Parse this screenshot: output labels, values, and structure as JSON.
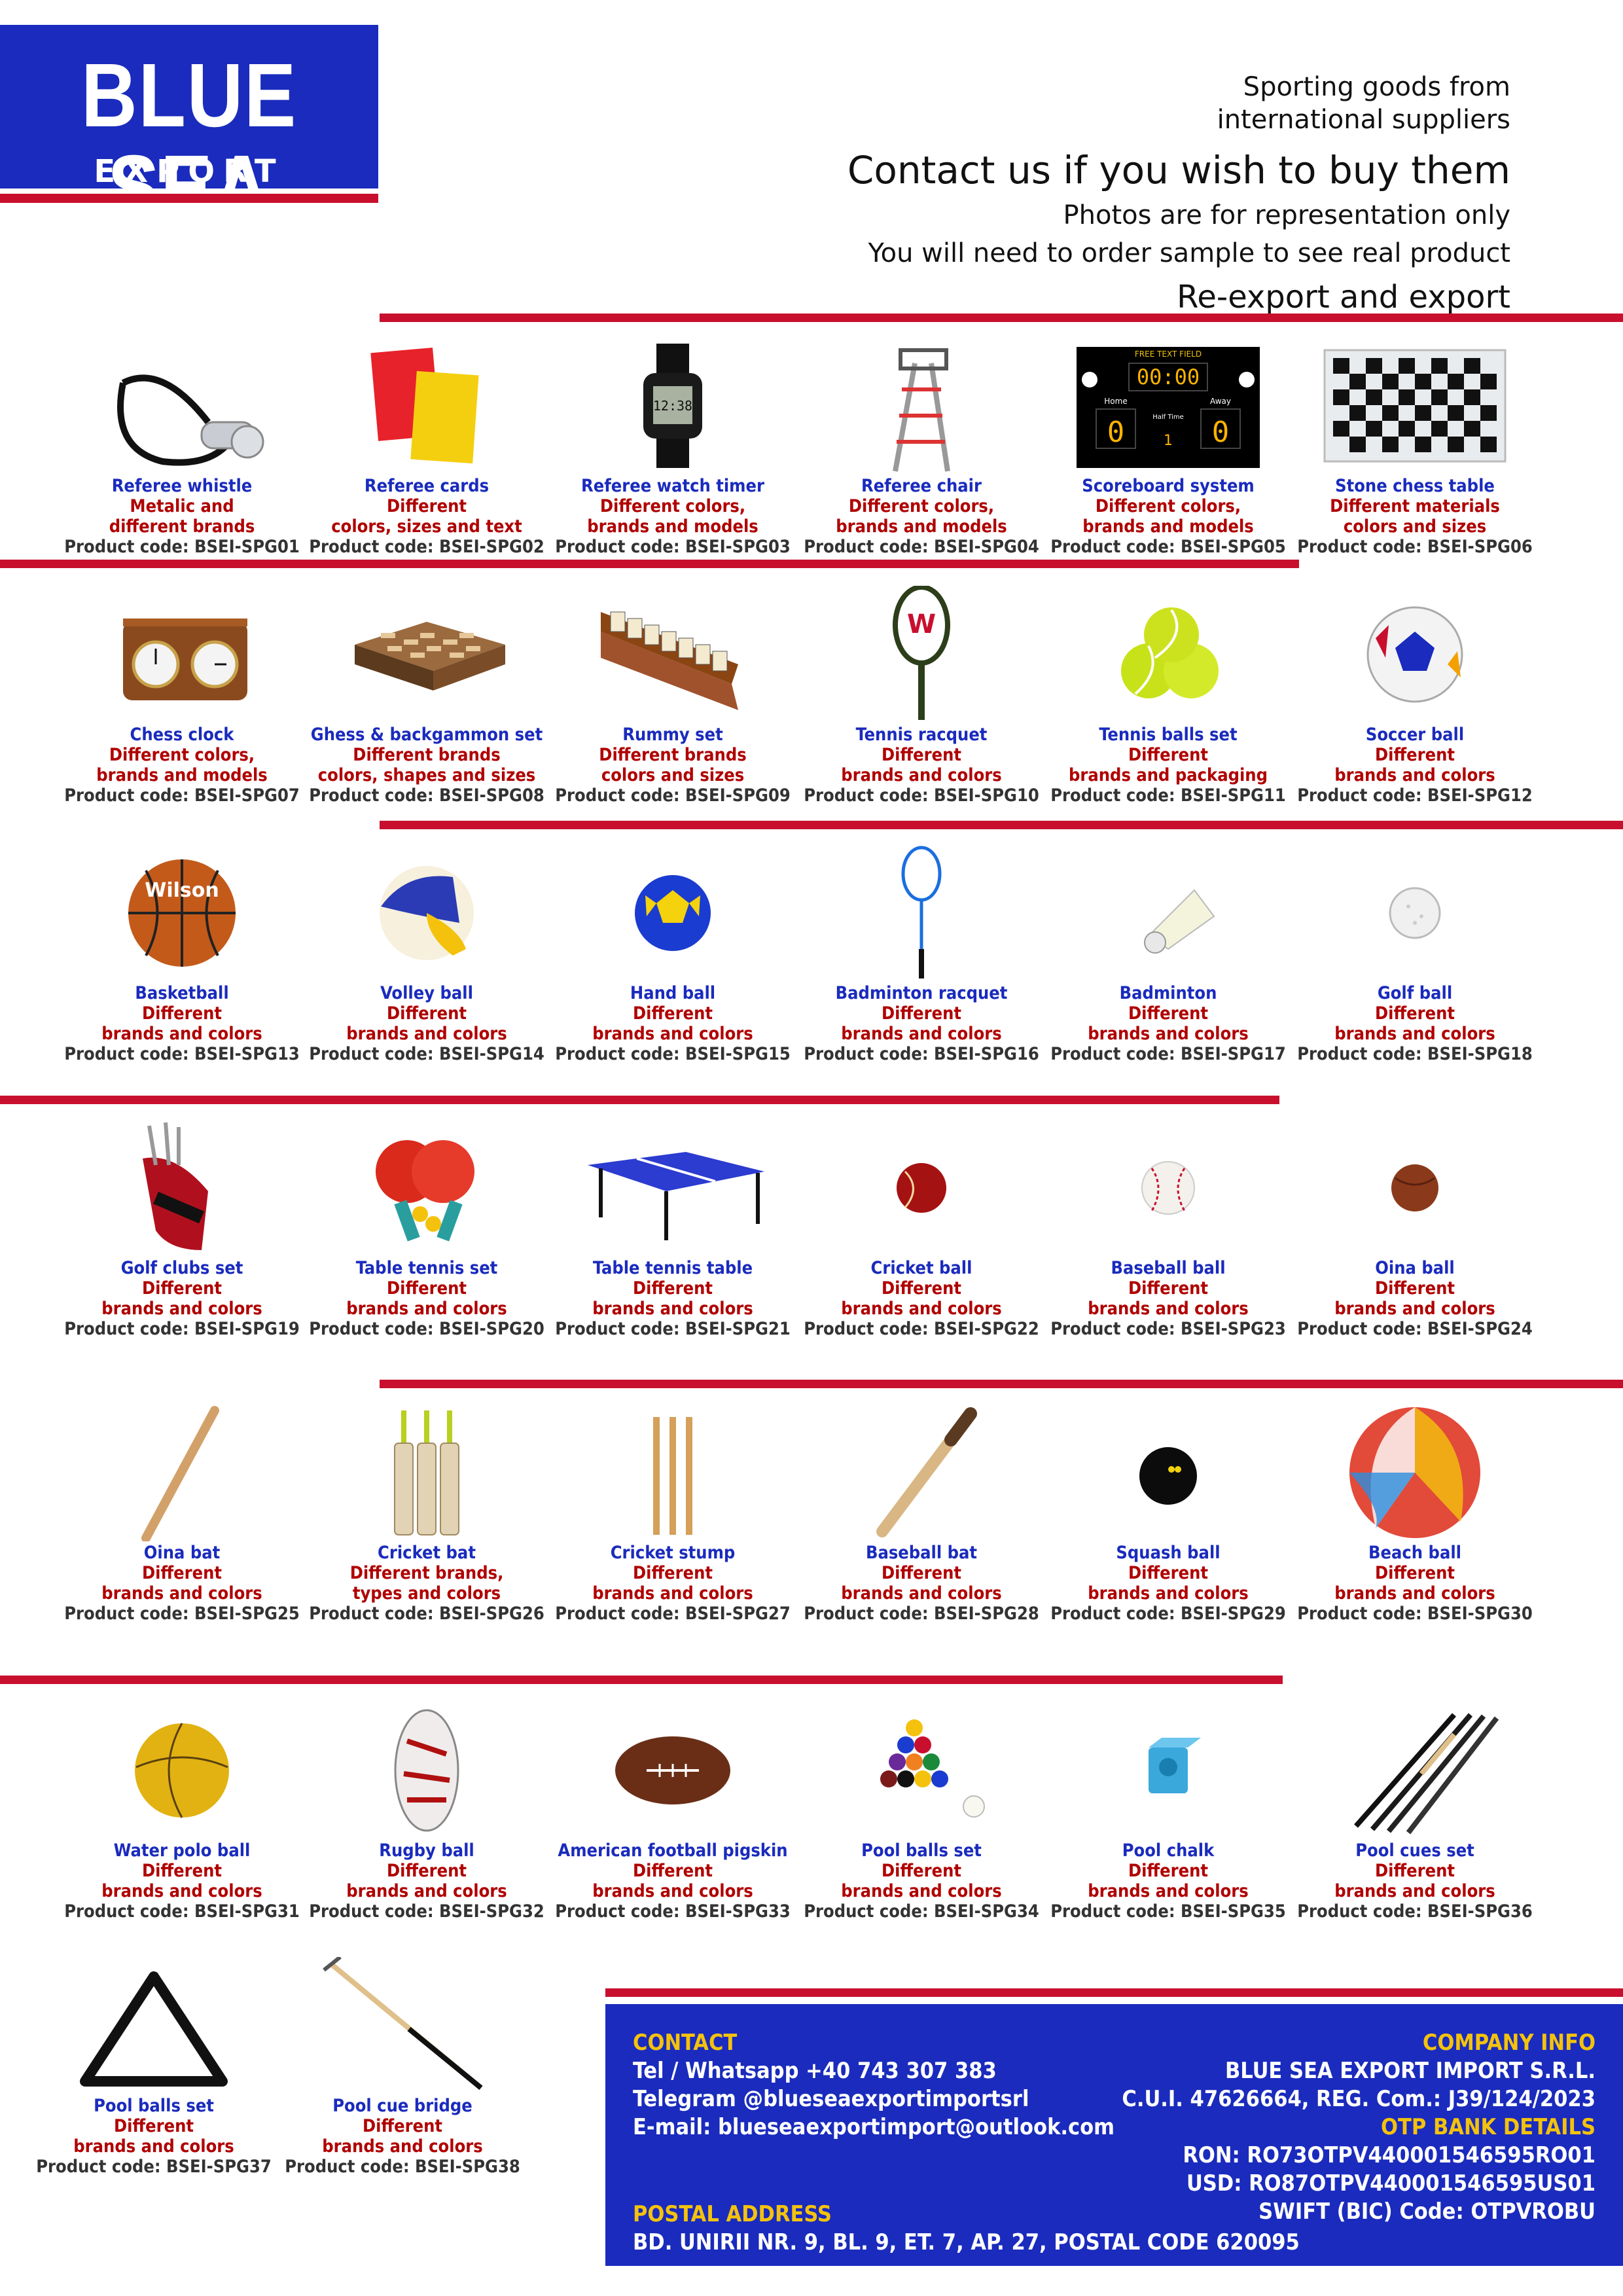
{
  "logo": {
    "title": "BLUE SEA",
    "subtitle": "EXPORT IMPORT"
  },
  "header": {
    "tagline_1": "Sporting goods from",
    "tagline_2": "international suppliers",
    "contact": "Contact us if you wish to buy them",
    "note_1": "Photos are for representation only",
    "note_2": "You will need to order sample to see real product",
    "export": "Re-export and export"
  },
  "colors": {
    "brand_blue": "#1a2bbd",
    "accent_red": "#c8102e",
    "footer_heading": "#f4c20d"
  },
  "products": [
    {
      "name": "Referee whistle",
      "desc": [
        "Metalic and",
        "different brands"
      ],
      "code": "Product code: BSEI-SPG01",
      "icon": "whistle-icon"
    },
    {
      "name": "Referee cards",
      "desc": [
        "Different",
        "colors, sizes and text"
      ],
      "code": "Product code: BSEI-SPG02",
      "icon": "referee-cards-icon"
    },
    {
      "name": "Referee watch timer",
      "desc": [
        "Different colors,",
        "brands and models"
      ],
      "code": "Product code: BSEI-SPG03",
      "icon": "watch-icon"
    },
    {
      "name": "Referee chair",
      "desc": [
        "Different colors,",
        "brands and models"
      ],
      "code": "Product code: BSEI-SPG04",
      "icon": "referee-chair-icon"
    },
    {
      "name": "Scoreboard system",
      "desc": [
        "Different colors,",
        "brands and models"
      ],
      "code": "Product code: BSEI-SPG05",
      "icon": "scoreboard-icon"
    },
    {
      "name": "Stone chess table",
      "desc": [
        "Different materials",
        "colors and sizes"
      ],
      "code": "Product code: BSEI-SPG06",
      "icon": "chess-table-icon"
    },
    {
      "name": "Chess clock",
      "desc": [
        "Different colors,",
        "brands and models"
      ],
      "code": "Product code: BSEI-SPG07",
      "icon": "chess-clock-icon"
    },
    {
      "name": "Ghess & backgammon set",
      "desc": [
        "Different brands",
        "colors, shapes and sizes"
      ],
      "code": "Product code: BSEI-SPG08",
      "icon": "backgammon-icon"
    },
    {
      "name": "Rummy set",
      "desc": [
        "Different brands",
        "colors and sizes"
      ],
      "code": "Product code: BSEI-SPG09",
      "icon": "rummy-icon"
    },
    {
      "name": "Tennis racquet",
      "desc": [
        "Different",
        "brands and colors"
      ],
      "code": "Product code: BSEI-SPG10",
      "icon": "tennis-racquet-icon"
    },
    {
      "name": "Tennis balls set",
      "desc": [
        "Different",
        "brands and packaging"
      ],
      "code": "Product code: BSEI-SPG11",
      "icon": "tennis-balls-icon"
    },
    {
      "name": "Soccer ball",
      "desc": [
        "Different",
        "brands and colors"
      ],
      "code": "Product code: BSEI-SPG12",
      "icon": "soccer-ball-icon"
    },
    {
      "name": "Basketball",
      "desc": [
        "Different",
        "brands and colors"
      ],
      "code": "Product code: BSEI-SPG13",
      "icon": "basketball-icon"
    },
    {
      "name": "Volley ball",
      "desc": [
        "Different",
        "brands and colors"
      ],
      "code": "Product code: BSEI-SPG14",
      "icon": "volleyball-icon"
    },
    {
      "name": "Hand ball",
      "desc": [
        "Different",
        "brands and colors"
      ],
      "code": "Product code: BSEI-SPG15",
      "icon": "handball-icon"
    },
    {
      "name": "Badminton racquet",
      "desc": [
        "Different",
        "brands and colors"
      ],
      "code": "Product code: BSEI-SPG16",
      "icon": "badminton-racquet-icon"
    },
    {
      "name": "Badminton",
      "desc": [
        "Different",
        "brands and colors"
      ],
      "code": "Product code: BSEI-SPG17",
      "icon": "shuttlecock-icon"
    },
    {
      "name": "Golf ball",
      "desc": [
        "Different",
        "brands and colors"
      ],
      "code": "Product code: BSEI-SPG18",
      "icon": "golf-ball-icon"
    },
    {
      "name": "Golf clubs set",
      "desc": [
        "Different",
        "brands and colors"
      ],
      "code": "Product code: BSEI-SPG19",
      "icon": "golf-bag-icon"
    },
    {
      "name": "Table tennis set",
      "desc": [
        "Different",
        "brands and colors"
      ],
      "code": "Product code: BSEI-SPG20",
      "icon": "ping-pong-icon"
    },
    {
      "name": "Table tennis table",
      "desc": [
        "Different",
        "brands and colors"
      ],
      "code": "Product code: BSEI-SPG21",
      "icon": "ping-pong-table-icon"
    },
    {
      "name": "Cricket ball",
      "desc": [
        "Different",
        "brands and colors"
      ],
      "code": "Product code: BSEI-SPG22",
      "icon": "cricket-ball-icon"
    },
    {
      "name": "Baseball ball",
      "desc": [
        "Different",
        "brands and colors"
      ],
      "code": "Product code: BSEI-SPG23",
      "icon": "baseball-icon"
    },
    {
      "name": "Oina ball",
      "desc": [
        "Different",
        "brands and colors"
      ],
      "code": "Product code: BSEI-SPG24",
      "icon": "oina-ball-icon"
    },
    {
      "name": "Oina bat",
      "desc": [
        "Different",
        "brands and colors"
      ],
      "code": "Product code: BSEI-SPG25",
      "icon": "oina-bat-icon"
    },
    {
      "name": "Cricket bat",
      "desc": [
        "Different brands,",
        "types and colors"
      ],
      "code": "Product code: BSEI-SPG26",
      "icon": "cricket-bat-icon"
    },
    {
      "name": "Cricket stump",
      "desc": [
        "Different",
        "brands and colors"
      ],
      "code": "Product code: BSEI-SPG27",
      "icon": "cricket-stump-icon"
    },
    {
      "name": "Baseball bat",
      "desc": [
        "Different",
        "brands and colors"
      ],
      "code": "Product code: BSEI-SPG28",
      "icon": "baseball-bat-icon"
    },
    {
      "name": "Squash ball",
      "desc": [
        "Different",
        "brands and colors"
      ],
      "code": "Product code: BSEI-SPG29",
      "icon": "squash-ball-icon"
    },
    {
      "name": "Beach ball",
      "desc": [
        "Different",
        "brands and colors"
      ],
      "code": "Product code: BSEI-SPG30",
      "icon": "beach-ball-icon"
    },
    {
      "name": "Water polo ball",
      "desc": [
        "Different",
        "brands and colors"
      ],
      "code": "Product code: BSEI-SPG31",
      "icon": "water-polo-ball-icon"
    },
    {
      "name": "Rugby ball",
      "desc": [
        "Different",
        "brands and colors"
      ],
      "code": "Product code: BSEI-SPG32",
      "icon": "rugby-ball-icon"
    },
    {
      "name": "American football pigskin",
      "desc": [
        "Different",
        "brands and colors"
      ],
      "code": "Product code: BSEI-SPG33",
      "icon": "american-football-icon"
    },
    {
      "name": "Pool balls set",
      "desc": [
        "Different",
        "brands and colors"
      ],
      "code": "Product code: BSEI-SPG34",
      "icon": "pool-balls-icon"
    },
    {
      "name": "Pool chalk",
      "desc": [
        "Different",
        "brands and colors"
      ],
      "code": "Product code: BSEI-SPG35",
      "icon": "pool-chalk-icon"
    },
    {
      "name": "Pool cues set",
      "desc": [
        "Different",
        "brands and colors"
      ],
      "code": "Product code: BSEI-SPG36",
      "icon": "pool-cues-icon"
    },
    {
      "name": "Pool balls set",
      "desc": [
        "Different",
        "brands and colors"
      ],
      "code": "Product code: BSEI-SPG37",
      "icon": "pool-rack-icon"
    },
    {
      "name": "Pool cue bridge",
      "desc": [
        "Different",
        "brands and colors"
      ],
      "code": "Product code: BSEI-SPG38",
      "icon": "cue-bridge-icon"
    }
  ],
  "footer": {
    "contact_heading": "CONTACT",
    "phone": "Tel / Whatsapp +40 743 307 383",
    "telegram": "Telegram @blueseaexportimportsrl",
    "email": "E-mail: blueseaexportimport@outlook.com",
    "postal_heading": "POSTAL ADDRESS",
    "postal_address": "BD. UNIRII NR. 9, BL. 9, ET. 7, AP. 27, POSTAL CODE 620095",
    "company_heading": "COMPANY INFO",
    "company_name": "BLUE SEA EXPORT IMPORT S.R.L.",
    "company_reg": "C.U.I. 47626664, REG. Com.: J39/124/2023",
    "bank_heading": "OTP BANK DETAILS",
    "ron": "RON: RO73OTPV440001546595RO01",
    "usd": "USD: RO87OTPV440001546595US01",
    "swift": "SWIFT (BIC) Code: OTPVROBU"
  },
  "scoreboard": {
    "label": "FREE TEXT FIELD",
    "time": "00:00",
    "home": "Home",
    "away": "Away",
    "half": "Half Time",
    "home_score": "0",
    "away_score": "0",
    "period": "1"
  },
  "watch_display": "12:38"
}
